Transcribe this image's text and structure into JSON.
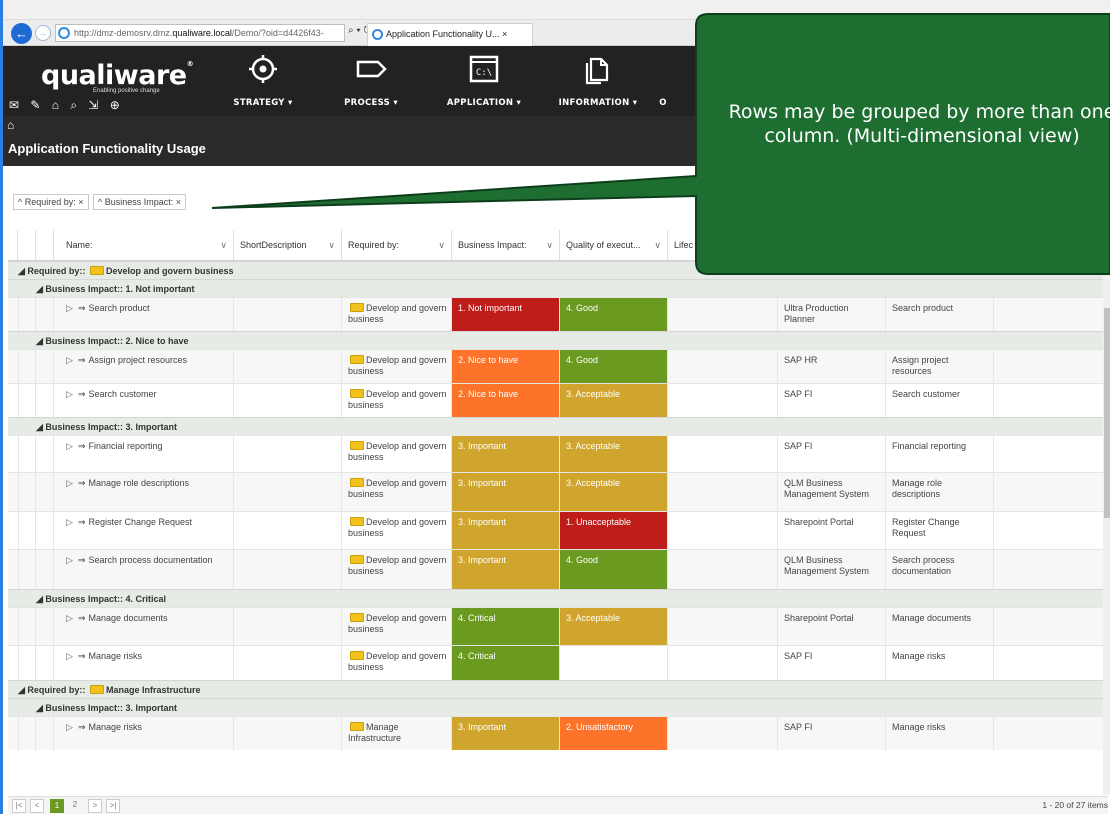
{
  "browser": {
    "url_prefix": "http://dmz-demosrv.dmz.",
    "url_domain": "qualiware.local",
    "url_suffix": "/Demo/?oid=d4426f43-",
    "url_controls": "⌕ ▾ ↻",
    "tab_title": "Application Functionality U... ×"
  },
  "header": {
    "logo": "qualiware",
    "logo_mark": "®",
    "tagline": "Enabling positive change",
    "tool_icons": "✉ ✎ ⌂ ⌕ ⇲ ⊕",
    "menu": [
      {
        "label": "STRATEGY ▾",
        "icon": "target-icon"
      },
      {
        "label": "PROCESS ▾",
        "icon": "process-icon"
      },
      {
        "label": "APPLICATION ▾",
        "icon": "terminal-icon"
      },
      {
        "label": "INFORMATION ▾",
        "icon": "documents-icon"
      },
      {
        "label": "O",
        "icon": "more-icon"
      }
    ]
  },
  "page": {
    "home_icon": "⌂",
    "title": "Application Functionality Usage"
  },
  "group_chips": [
    "^ Required by:  ×",
    "^ Business Impact:  ×"
  ],
  "columns": {
    "name": "Name:",
    "short": "ShortDescription",
    "req": "Required by:",
    "bi": "Business Impact:",
    "qe": "Quality of execut...",
    "life": "Lifec",
    "sort_glyph": "∨"
  },
  "colors": {
    "not_important": "#be1d19",
    "nice_to_have": "#fd732a",
    "important": "#cfa52e",
    "critical": "#6a9a1f",
    "good": "#6a9a1f",
    "acceptable": "#cfa52e",
    "unacceptable": "#be1d19",
    "unsatisfactory": "#fd732a",
    "callout": "#1e6e32"
  },
  "rows": [
    {
      "type": "g1",
      "label": "◢ Required by::",
      "value": "Develop and govern business"
    },
    {
      "type": "g2",
      "label": "◢ Business Impact::",
      "value": "1. Not important"
    },
    {
      "type": "d",
      "h": 34,
      "name": "Search product",
      "req": "Develop and govern business",
      "bi": "1. Not important",
      "bic": "not_important",
      "qe": "4. Good",
      "qec": "good",
      "app": "Ultra Production Planner",
      "func": "Search product"
    },
    {
      "type": "g2",
      "label": "◢ Business Impact::",
      "value": "2. Nice to have"
    },
    {
      "type": "d",
      "h": 34,
      "name": "Assign project resources",
      "req": "Develop and govern business",
      "bi": "2. Nice to have",
      "bic": "nice_to_have",
      "qe": "4. Good",
      "qec": "good",
      "app": "SAP HR",
      "func": "Assign project resources"
    },
    {
      "type": "d",
      "h": 34,
      "name": "Search customer",
      "req": "Develop and govern business",
      "bi": "2. Nice to have",
      "bic": "nice_to_have",
      "qe": "3. Acceptable",
      "qec": "acceptable",
      "app": "SAP FI",
      "func": "Search customer"
    },
    {
      "type": "g2",
      "label": "◢ Business Impact::",
      "value": "3. Important"
    },
    {
      "type": "d",
      "h": 37,
      "name": "Financial reporting",
      "req": "Develop and govern business",
      "bi": "3. Important",
      "bic": "important",
      "qe": "3. Acceptable",
      "qec": "acceptable",
      "app": "SAP FI",
      "func": "Financial reporting"
    },
    {
      "type": "d",
      "h": 39,
      "name": "Manage role descriptions",
      "req": "Develop and govern business",
      "bi": "3. Important",
      "bic": "important",
      "qe": "3. Acceptable",
      "qec": "acceptable",
      "app": "QLM Business Management System",
      "func": "Manage role descriptions"
    },
    {
      "type": "d",
      "h": 38,
      "name": "Register Change Request",
      "req": "Develop and govern business",
      "bi": "3. Important",
      "bic": "important",
      "qe": "1. Unacceptable",
      "qec": "unacceptable",
      "app": "Sharepoint Portal",
      "func": "Register Change Request"
    },
    {
      "type": "d",
      "h": 40,
      "name": "Search process documentation",
      "req": "Develop and govern business",
      "bi": "3. Important",
      "bic": "important",
      "qe": "4. Good",
      "qec": "good",
      "app": "QLM Business Management System",
      "func": "Search process documentation"
    },
    {
      "type": "g2",
      "label": "◢ Business Impact::",
      "value": "4. Critical"
    },
    {
      "type": "d",
      "h": 38,
      "name": "Manage documents",
      "req": "Develop and govern business",
      "bi": "4. Critical",
      "bic": "critical",
      "qe": "3. Acceptable",
      "qec": "acceptable",
      "app": "Sharepoint Portal",
      "func": "Manage documents"
    },
    {
      "type": "d",
      "h": 35,
      "name": "Manage risks",
      "req": "Develop and govern business",
      "bi": "4. Critical",
      "bic": "critical",
      "qe": "",
      "qec": "",
      "app": "SAP FI",
      "func": "Manage risks"
    },
    {
      "type": "g1",
      "label": "◢ Required by::",
      "value": "Manage Infrastructure"
    },
    {
      "type": "g2",
      "label": "◢ Business Impact::",
      "value": "3. Important"
    },
    {
      "type": "d",
      "h": 34,
      "name": "Manage risks",
      "req": "Manage Infrastructure",
      "bi": "3. Important",
      "bic": "important",
      "qe": "2. Unsatisfactory",
      "qec": "unsatisfactory",
      "app": "SAP FI",
      "func": "Manage risks"
    }
  ],
  "pager": {
    "first": "|<",
    "prev": "<",
    "pages": [
      "1",
      "2"
    ],
    "next": ">",
    "last": ">|",
    "count": "1 - 20 of 27 items"
  },
  "callout": {
    "text": "Rows may be grouped by more than one column. (Multi-dimensional view)"
  }
}
